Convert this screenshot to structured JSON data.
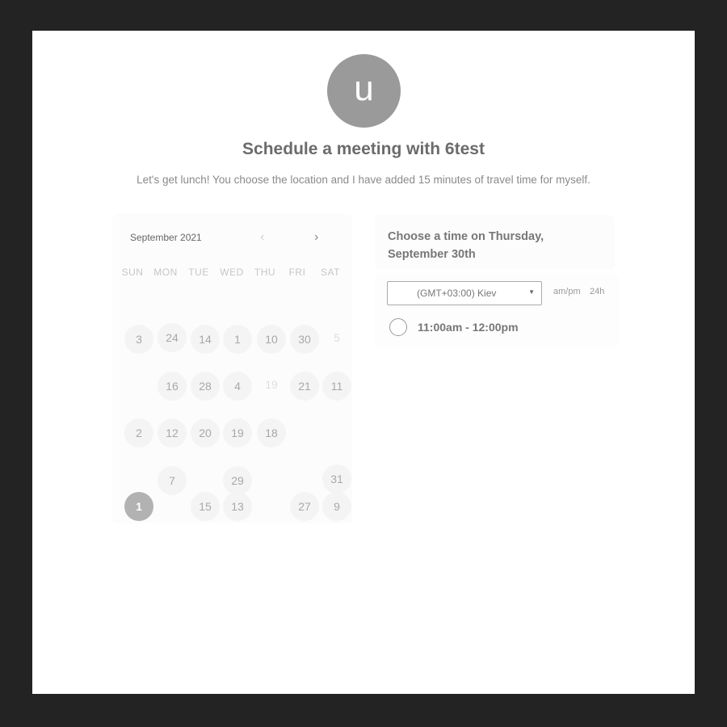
{
  "avatar": {
    "letter": "u"
  },
  "title": "Schedule a meeting with 6test",
  "subtitle": "Let's get lunch! You choose the location and I have added 15 minutes of travel time for myself.",
  "calendar": {
    "month": "September 2021",
    "prev_icon": "chevron-left-icon",
    "next_icon": "chevron-right-icon",
    "weekdays": [
      "SUN",
      "MON",
      "TUE",
      "WED",
      "THU",
      "FRI",
      "SAT"
    ],
    "rows": [
      [
        "3",
        "24",
        "14",
        "1",
        "10",
        "30",
        "5"
      ],
      [
        "",
        "16",
        "28",
        "4",
        "19",
        "21",
        "11"
      ],
      [
        "2",
        "12",
        "20",
        "19",
        "18",
        "",
        ""
      ],
      [
        "",
        "7",
        "",
        "29",
        "",
        "",
        "31"
      ],
      [
        "1",
        "",
        "15",
        "13",
        "",
        "27",
        "9"
      ]
    ],
    "selected_day": "1"
  },
  "time_panel": {
    "header": "Choose a time on Thursday, September 30th",
    "timezone": "(GMT+03:00) Kiev",
    "format_ampm": "am/pm",
    "format_24h": "24h",
    "slots": [
      "11:00am - 12:00pm"
    ]
  },
  "colors": {
    "background": "#232323",
    "card": "#ffffff",
    "avatar": "#9a9a9a",
    "selected_day": "#b2b2b2"
  }
}
